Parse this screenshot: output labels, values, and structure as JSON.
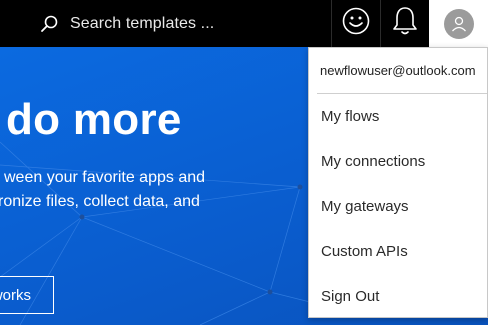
{
  "header": {
    "search_placeholder": "Search templates ...",
    "icons": [
      "search-icon",
      "smiley-icon",
      "bell-icon",
      "user-avatar-icon"
    ]
  },
  "hero": {
    "title": "do more",
    "line1": "ween your favorite apps and",
    "line2": "ronize files, collect data, and",
    "button_label": "works"
  },
  "account_menu": {
    "email": "newflowuser@outlook.com",
    "items": [
      {
        "label": "My flows"
      },
      {
        "label": "My connections"
      },
      {
        "label": "My gateways"
      },
      {
        "label": "Custom APIs"
      },
      {
        "label": "Sign Out"
      }
    ]
  },
  "colors": {
    "topbar": "#000000",
    "hero_blue": "#0a62d6",
    "menu_bg": "#ffffff"
  }
}
